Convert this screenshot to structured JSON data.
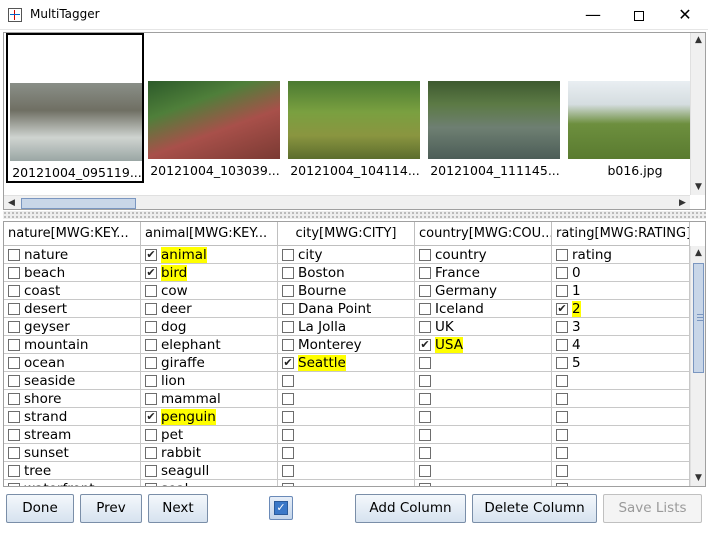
{
  "window": {
    "title": "MultiTagger"
  },
  "thumbnails": [
    {
      "caption": "20121004_095119...",
      "image": "penguins",
      "selected": true
    },
    {
      "caption": "20121004_103039...",
      "image": "park-path",
      "selected": false
    },
    {
      "caption": "20121004_104114...",
      "image": "giraffe",
      "selected": false
    },
    {
      "caption": "20121004_111145...",
      "image": "swan-pond",
      "selected": false
    },
    {
      "caption": "b016.jpg",
      "image": "farm-field",
      "selected": false
    }
  ],
  "table": {
    "headers": [
      "nature[MWG:KEY...",
      "animal[MWG:KEY...",
      "city[MWG:CITY]",
      "country[MWG:COU...",
      "rating[MWG:RATING]"
    ],
    "columns": [
      {
        "items": [
          {
            "label": "nature",
            "checked": false
          },
          {
            "label": "beach",
            "checked": false
          },
          {
            "label": "coast",
            "checked": false
          },
          {
            "label": "desert",
            "checked": false
          },
          {
            "label": "geyser",
            "checked": false
          },
          {
            "label": "mountain",
            "checked": false
          },
          {
            "label": "ocean",
            "checked": false
          },
          {
            "label": "seaside",
            "checked": false
          },
          {
            "label": "shore",
            "checked": false
          },
          {
            "label": "strand",
            "checked": false
          },
          {
            "label": "stream",
            "checked": false
          },
          {
            "label": "sunset",
            "checked": false
          },
          {
            "label": "tree",
            "checked": false
          },
          {
            "label": "waterfront",
            "checked": false
          }
        ]
      },
      {
        "items": [
          {
            "label": "animal",
            "checked": true
          },
          {
            "label": "bird",
            "checked": true
          },
          {
            "label": "cow",
            "checked": false
          },
          {
            "label": "deer",
            "checked": false
          },
          {
            "label": "dog",
            "checked": false
          },
          {
            "label": "elephant",
            "checked": false
          },
          {
            "label": "giraffe",
            "checked": false
          },
          {
            "label": "lion",
            "checked": false
          },
          {
            "label": "mammal",
            "checked": false
          },
          {
            "label": "penguin",
            "checked": true
          },
          {
            "label": "pet",
            "checked": false
          },
          {
            "label": "rabbit",
            "checked": false
          },
          {
            "label": "seagull",
            "checked": false
          },
          {
            "label": "seal",
            "checked": false
          }
        ]
      },
      {
        "items": [
          {
            "label": "city",
            "checked": false
          },
          {
            "label": "Boston",
            "checked": false
          },
          {
            "label": "Bourne",
            "checked": false
          },
          {
            "label": "Dana Point",
            "checked": false
          },
          {
            "label": "La Jolla",
            "checked": false
          },
          {
            "label": "Monterey",
            "checked": false
          },
          {
            "label": "Seattle",
            "checked": true
          },
          {
            "label": "",
            "checked": false
          },
          {
            "label": "",
            "checked": false
          },
          {
            "label": "",
            "checked": false
          },
          {
            "label": "",
            "checked": false
          },
          {
            "label": "",
            "checked": false
          },
          {
            "label": "",
            "checked": false
          },
          {
            "label": "",
            "checked": false
          }
        ]
      },
      {
        "items": [
          {
            "label": "country",
            "checked": false
          },
          {
            "label": "France",
            "checked": false
          },
          {
            "label": "Germany",
            "checked": false
          },
          {
            "label": "Iceland",
            "checked": false
          },
          {
            "label": "UK",
            "checked": false
          },
          {
            "label": "USA",
            "checked": true
          },
          {
            "label": "",
            "checked": false
          },
          {
            "label": "",
            "checked": false
          },
          {
            "label": "",
            "checked": false
          },
          {
            "label": "",
            "checked": false
          },
          {
            "label": "",
            "checked": false
          },
          {
            "label": "",
            "checked": false
          },
          {
            "label": "",
            "checked": false
          },
          {
            "label": "",
            "checked": false
          }
        ]
      },
      {
        "items": [
          {
            "label": "rating",
            "checked": false
          },
          {
            "label": "0",
            "checked": false
          },
          {
            "label": "1",
            "checked": false
          },
          {
            "label": "2",
            "checked": true
          },
          {
            "label": "3",
            "checked": false
          },
          {
            "label": "4",
            "checked": false
          },
          {
            "label": "5",
            "checked": false
          },
          {
            "label": "",
            "checked": false
          },
          {
            "label": "",
            "checked": false
          },
          {
            "label": "",
            "checked": false
          },
          {
            "label": "",
            "checked": false
          },
          {
            "label": "",
            "checked": false
          },
          {
            "label": "",
            "checked": false
          },
          {
            "label": "",
            "checked": false
          }
        ]
      }
    ]
  },
  "buttons": {
    "done": "Done",
    "prev": "Prev",
    "next": "Next",
    "add_column": "Add Column",
    "delete_column": "Delete Column",
    "save_lists": "Save Lists"
  },
  "toggle_checked": true,
  "colors": {
    "highlight": "#ffff00",
    "accent": "#3a78c8"
  }
}
